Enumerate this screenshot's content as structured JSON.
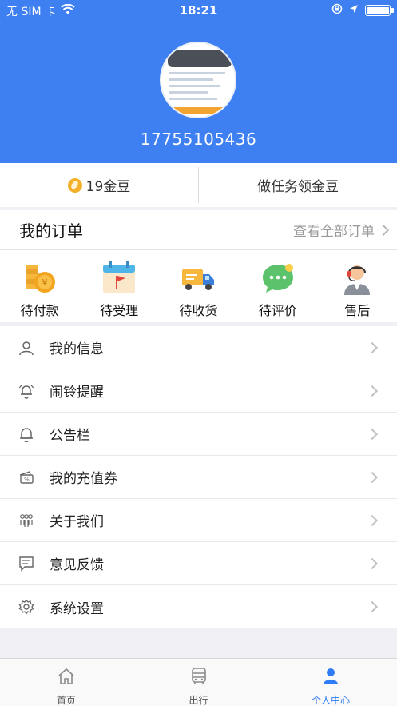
{
  "status_bar": {
    "carrier": "无 SIM 卡",
    "time": "18:21",
    "icons": [
      "wifi-icon",
      "orientation-lock-icon",
      "location-icon",
      "battery-icon"
    ]
  },
  "profile": {
    "phone": "17755105436"
  },
  "beans": {
    "count_label": "19金豆",
    "task_label": "做任务领金豆"
  },
  "orders": {
    "title": "我的订单",
    "view_all": "查看全部订单",
    "items": [
      {
        "label": "待付款",
        "icon": "coins-icon"
      },
      {
        "label": "待受理",
        "icon": "calendar-flag-icon"
      },
      {
        "label": "待收货",
        "icon": "delivery-truck-icon"
      },
      {
        "label": "待评价",
        "icon": "chat-bubble-icon"
      },
      {
        "label": "售后",
        "icon": "customer-service-icon"
      }
    ]
  },
  "menu": {
    "items": [
      {
        "label": "我的信息",
        "icon": "user-icon"
      },
      {
        "label": "闹铃提醒",
        "icon": "alarm-bell-icon"
      },
      {
        "label": "公告栏",
        "icon": "bell-icon"
      },
      {
        "label": "我的充值券",
        "icon": "voucher-icon"
      },
      {
        "label": "关于我们",
        "icon": "team-icon"
      },
      {
        "label": "意见反馈",
        "icon": "feedback-icon"
      },
      {
        "label": "系统设置",
        "icon": "gear-icon"
      }
    ]
  },
  "tabbar": {
    "tabs": [
      {
        "label": "首页",
        "icon": "home-icon",
        "active": false
      },
      {
        "label": "出行",
        "icon": "bus-icon",
        "active": false
      },
      {
        "label": "个人中心",
        "icon": "person-icon",
        "active": true
      }
    ]
  },
  "colors": {
    "header_blue": "#3e80f2",
    "active_tab": "#2f7cf6"
  }
}
